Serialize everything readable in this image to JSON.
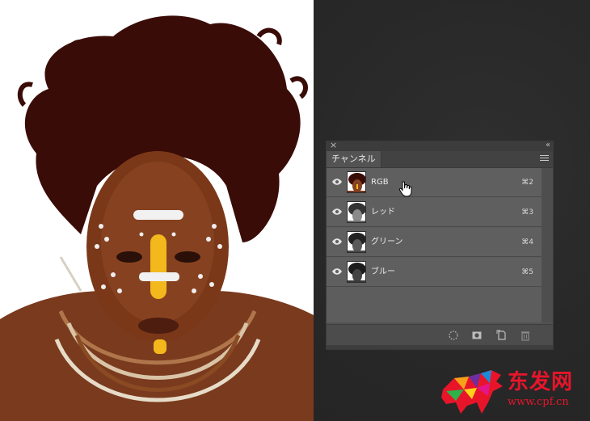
{
  "panel": {
    "tab_label": "チャンネル",
    "close_icon": "close-icon",
    "collapse_icon": "double-chevron-icon",
    "menu_icon": "panel-menu-icon"
  },
  "channels": [
    {
      "name": "RGB",
      "shortcut": "⌘2",
      "thumb": "color"
    },
    {
      "name": "レッド",
      "shortcut": "⌘3",
      "thumb": "gray"
    },
    {
      "name": "グリーン",
      "shortcut": "⌘4",
      "thumb": "gray"
    },
    {
      "name": "ブルー",
      "shortcut": "⌘5",
      "thumb": "gray"
    }
  ],
  "footer_icons": [
    "load-selection-icon",
    "save-selection-icon",
    "new-channel-icon",
    "trash-icon"
  ],
  "watermark": {
    "title": "东发网",
    "url": "www.cpf.cn"
  },
  "colors": {
    "panel_bg": "#535353",
    "workspace_bg": "#2a2a2a",
    "watermark_red": "#e8152a"
  }
}
